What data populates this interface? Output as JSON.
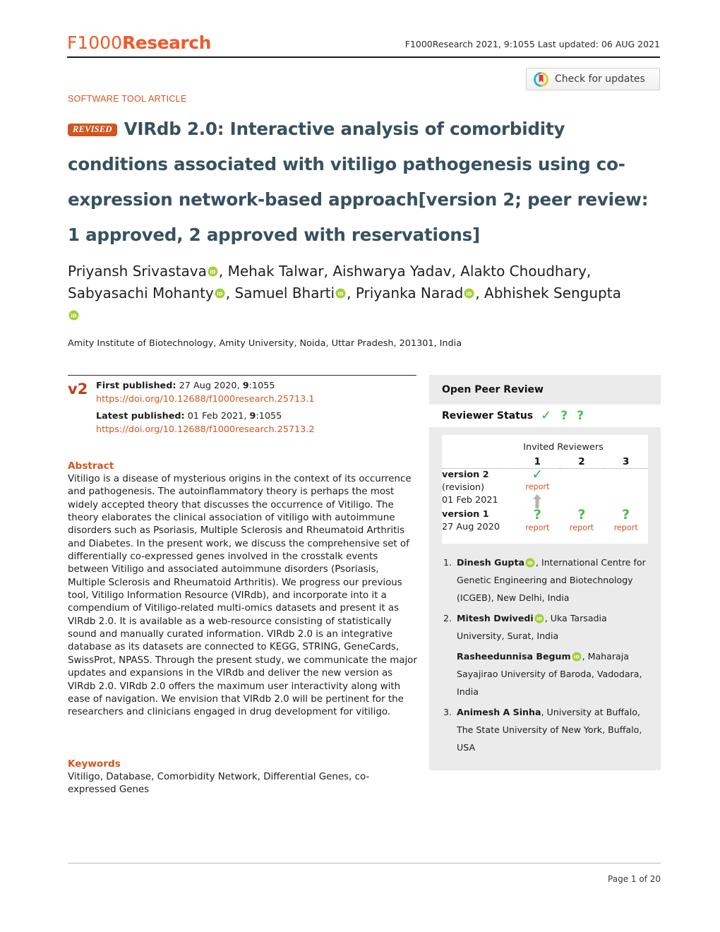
{
  "masthead": {
    "logo_f1000": "F1000",
    "logo_research": "Research",
    "meta": "F1000Research 2021, 9:1055 Last updated: 06 AUG 2021",
    "accent_color": "#f1592a"
  },
  "check_for_updates": {
    "label": "Check for updates",
    "icon": "crossmark-icon"
  },
  "article": {
    "kicker": "SOFTWARE TOOL ARTICLE",
    "revised_badge": "REVISED",
    "title": "VIRdb 2.0: Interactive analysis of comorbidity conditions associated with vitiligo pathogenesis using co-expression network-based approach",
    "version_note": "[version 2; peer review: 1 approved, 2 approved with reservations]",
    "title_color": "#37515f",
    "authors": [
      {
        "name": "Priyansh Srivastava",
        "orcid": true
      },
      {
        "name": "Mehak Talwar",
        "orcid": false
      },
      {
        "name": "Aishwarya Yadav",
        "orcid": false
      },
      {
        "name": "Alakto Choudhary",
        "orcid": false
      },
      {
        "name": "Sabyasachi Mohanty",
        "orcid": true
      },
      {
        "name": "Samuel Bharti",
        "orcid": true
      },
      {
        "name": "Priyanka Narad",
        "orcid": true
      },
      {
        "name": "Abhishek Sengupta",
        "orcid": true
      }
    ],
    "affiliation": "Amity Institute of Biotechnology, Amity University, Noida, Uttar Pradesh, 201301, India"
  },
  "publication": {
    "version_mark": "v2",
    "first_published_label": "First published:",
    "first_published_value": " 27 Aug 2020, ",
    "first_published_vol": "9",
    "first_published_page": ":1055",
    "first_doi": "https://doi.org/10.12688/f1000research.25713.1",
    "latest_published_label": "Latest published:",
    "latest_published_value": " 01 Feb 2021, ",
    "latest_published_vol": "9",
    "latest_published_page": ":1055",
    "latest_doi": "https://doi.org/10.12688/f1000research.25713.2"
  },
  "abstract": {
    "heading": "Abstract",
    "text": "Vitiligo is a disease of mysterious origins in the context of its occurrence and pathogenesis. The autoinflammatory theory is perhaps the most widely accepted theory that discusses the occurrence of Vitiligo. The theory elaborates the clinical association of vitiligo with autoimmune disorders such as Psoriasis, Multiple Sclerosis and Rheumatoid Arthritis and Diabetes. In the present work, we discuss the comprehensive set of differentially co-expressed genes involved in the crosstalk events between Vitiligo and associated autoimmune disorders (Psoriasis, Multiple Sclerosis and Rheumatoid Arthritis). We progress our previous tool, Vitiligo Information Resource (VIRdb), and incorporate into it a compendium of Vitiligo-related multi-omics datasets and present it as VIRdb 2.0. It is available as a web-resource consisting of statistically sound and manually curated information. VIRdb 2.0 is an integrative database as its datasets are connected to KEGG, STRING, GeneCards, SwissProt, NPASS. Through the present study, we communicate the major updates and expansions in the VIRdb and deliver the new version as VIRdb 2.0. VIRdb 2.0 offers the maximum user interactivity along with ease of navigation. We envision that VIRdb 2.0 will be pertinent for the researchers and clinicians engaged in drug development for vitiligo."
  },
  "keywords": {
    "heading": "Keywords",
    "text": "Vitiligo, Database, Comorbidity Network, Differential Genes, co-expressed Genes"
  },
  "peer_review": {
    "panel_title": "Open Peer Review",
    "status_label": "Reviewer Status",
    "status_icons": [
      "approved-tick-icon",
      "approved-with-reservations-icon",
      "approved-with-reservations-icon"
    ],
    "invited_reviewers_label": "Invited Reviewers",
    "reviewer_columns": [
      "1",
      "2",
      "3"
    ],
    "rows": [
      {
        "version": "version 2",
        "sub": "(revision)",
        "date": "01 Feb 2021",
        "cells": [
          {
            "status": "tick",
            "report": "report"
          },
          {
            "status": "none",
            "report": ""
          },
          {
            "status": "none",
            "report": ""
          }
        ],
        "has_arrow": true
      },
      {
        "version": "version 1",
        "sub": "",
        "date": "27 Aug 2020",
        "cells": [
          {
            "status": "question",
            "report": "report"
          },
          {
            "status": "question",
            "report": "report"
          },
          {
            "status": "question",
            "report": "report"
          }
        ],
        "has_arrow": false
      }
    ],
    "reviewers": [
      {
        "index": "1.",
        "name": "Dinesh Gupta",
        "orcid": true,
        "affiliation": ", International Centre for Genetic Engineering and Biotechnology (ICGEB), New Delhi, India",
        "numbered": true
      },
      {
        "index": "2.",
        "name": "Mitesh Dwivedi",
        "orcid": true,
        "affiliation": ", Uka Tarsadia University, Surat, India",
        "numbered": true
      },
      {
        "index": "",
        "name": "Rasheedunnisa Begum",
        "orcid": true,
        "affiliation": ", Maharaja Sayajirao University of Baroda, Vadodara, India",
        "numbered": false
      },
      {
        "index": "3.",
        "name": "Animesh A Sinha",
        "orcid": false,
        "affiliation": ", University at Buffalo, The State University of New York, Buffalo, USA",
        "numbered": true
      }
    ]
  },
  "footer": {
    "page_label": "Page 1 of 20"
  }
}
